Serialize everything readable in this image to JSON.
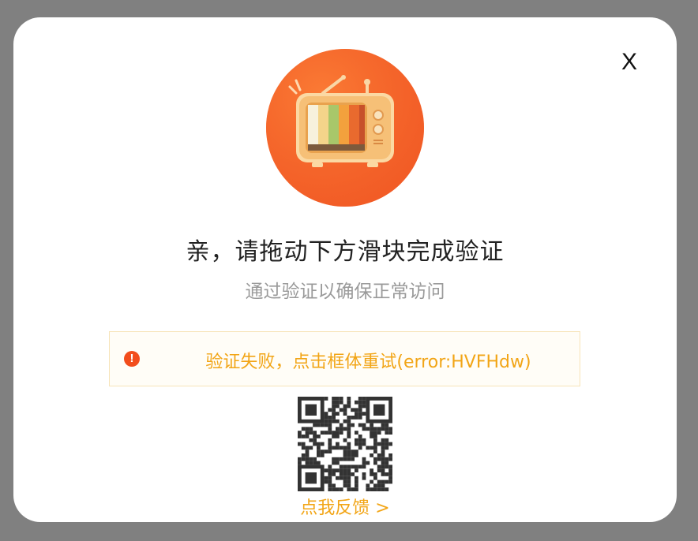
{
  "dialog": {
    "close_label": "X",
    "title": "亲，请拖动下方滑块完成验证",
    "subtitle": "通过验证以确保正常访问",
    "error": {
      "icon_symbol": "!",
      "message": "验证失败，点击框体重试(error:HVFHdw)"
    },
    "feedback_link": "点我反馈 >"
  },
  "colors": {
    "overlay": "#808080",
    "accent_orange": "#f2a516",
    "error_icon": "#f24d1c",
    "error_border": "#f7e4b8"
  },
  "icons": {
    "illustration": "tv-illustration-icon",
    "error": "exclamation-circle-icon",
    "qr": "qr-code"
  }
}
